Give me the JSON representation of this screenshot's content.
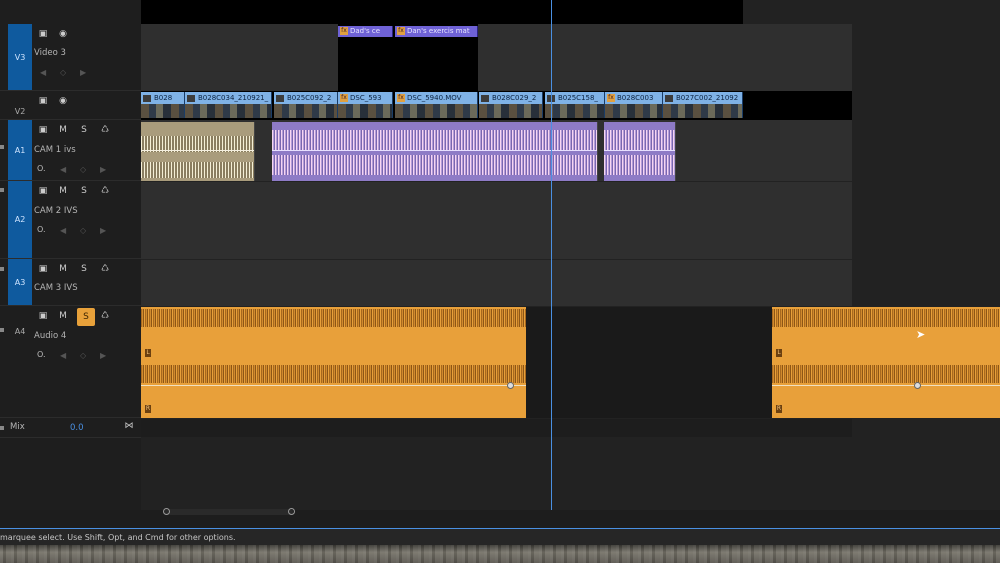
{
  "tracks": {
    "v3": {
      "target": "V3",
      "name": "Video 3"
    },
    "v2": {
      "target": "V2"
    },
    "a1": {
      "target": "A1",
      "name": "CAM 1 ivs",
      "m": "M",
      "s": "S"
    },
    "a2": {
      "target": "A2",
      "name": "CAM 2 IVS",
      "m": "M",
      "s": "S"
    },
    "a3": {
      "target": "A3",
      "name": "CAM 3 IVS",
      "m": "M",
      "s": "S"
    },
    "a4": {
      "target": "A4",
      "name": "Audio 4",
      "m": "M",
      "s": "S"
    },
    "mix": {
      "name": "Mix",
      "value": "0.0"
    }
  },
  "v3_clips": [
    "Dad's ce",
    "Dan's exercis mat"
  ],
  "v2_clips": [
    "B028",
    "B028C034_210921_",
    "B025C092_2",
    "DSC_593",
    "DSC_5940.MOV",
    "B028C029_2",
    "B025C158_",
    "B028C003",
    "B027C002_21092"
  ],
  "audio_channel_labels": {
    "left": "L",
    "right": "R"
  },
  "status": {
    "text": "marquee select. Use Shift, Opt, and Cmd for other options."
  },
  "colors": {
    "target_blue": "#0f5a9e",
    "video_clip": "#7fb2e6",
    "audio_clip_a1": "#a99c7c",
    "audio_clip_purple": "#8e7bc6",
    "audio_a4": "#e8a03a",
    "playhead": "#4a90e2"
  }
}
